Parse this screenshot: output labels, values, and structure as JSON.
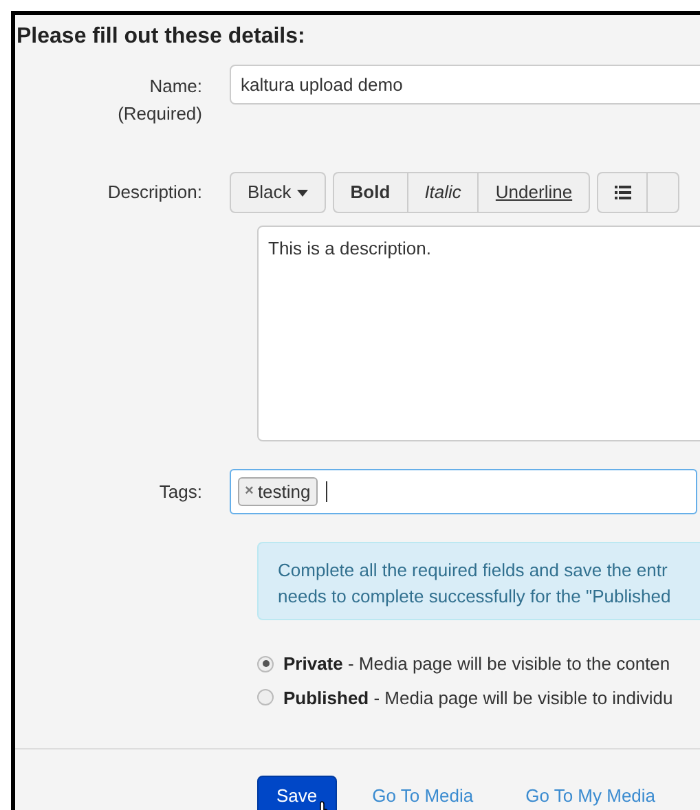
{
  "heading": "Please fill out these details:",
  "name_field": {
    "label": "Name:",
    "sublabel": "(Required)",
    "value": "kaltura upload demo"
  },
  "description": {
    "label": "Description:",
    "color_button": "Black",
    "format_buttons": [
      {
        "label": "Bold",
        "kind": "bold"
      },
      {
        "label": "Italic",
        "kind": "italic"
      },
      {
        "label": "Underline",
        "kind": "underline"
      }
    ],
    "value": "This is a description."
  },
  "tags": {
    "label": "Tags:",
    "items": [
      {
        "remove": "×",
        "label": "testing"
      }
    ]
  },
  "info": [
    "Complete all the required fields and save the entr",
    "needs to complete successfully for the \"Published"
  ],
  "visibility": [
    {
      "label": "Private",
      "text": " - Media page will be visible to the conten",
      "selected": true
    },
    {
      "label": "Published",
      "text": " - Media page will be visible to individu",
      "selected": false
    }
  ],
  "actions": {
    "save": "Save",
    "links": [
      "Go To Media",
      "Go To My Media"
    ]
  }
}
